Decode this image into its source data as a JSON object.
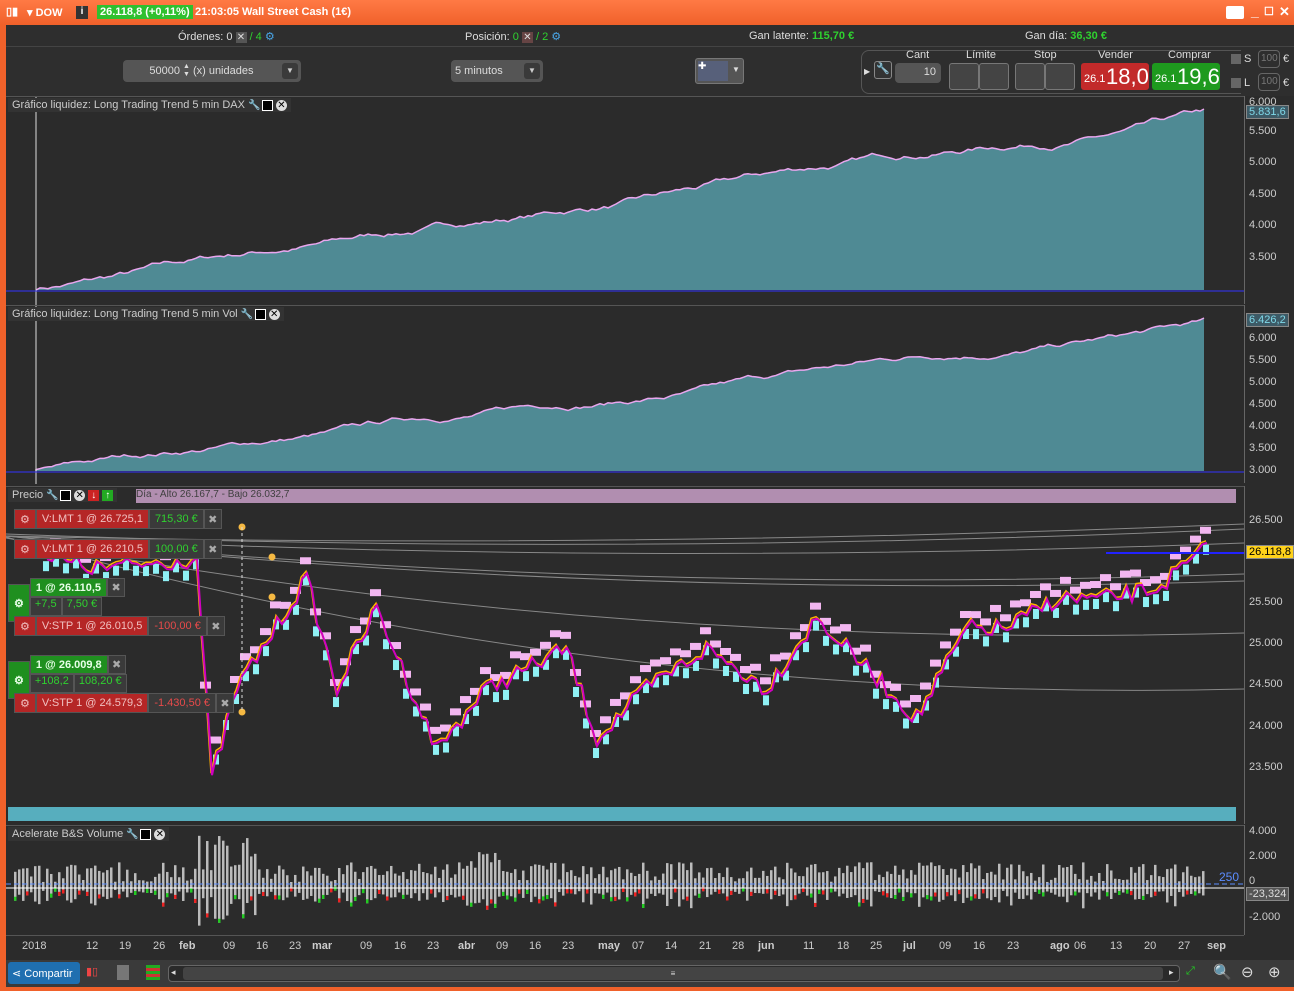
{
  "title": {
    "instrument": "DOW",
    "price": "26.118,8 (+0,11%)",
    "time": "21:03:05",
    "name": "Wall Street Cash (1€)"
  },
  "info": {
    "orders_label": "Órdenes:",
    "orders_a": "0",
    "orders_b": "/ 4",
    "position_label": "Posición:",
    "position_a": "0",
    "position_b": "/ 2",
    "latent_label": "Gan latente:",
    "latent_value": "115,70 €",
    "day_label": "Gan día:",
    "day_value": "36,30 €"
  },
  "controls": {
    "quantity": "50000",
    "units": "(x) unidades",
    "interval": "5 minutos",
    "cant_label": "Cant",
    "cant_value": "10",
    "limit_label": "Límite",
    "stop_label": "Stop",
    "sell_label": "Vender",
    "sell_prefix": "26.1",
    "sell_value": "18,0",
    "buy_label": "Comprar",
    "buy_prefix": "26.1",
    "buy_value": "19,6",
    "s_label": "S",
    "l_label": "L",
    "s_value": "100",
    "l_value": "100",
    "currency": "€"
  },
  "panel1": {
    "title": "Gráfico liquidez: Long Trading Trend 5 min DAX",
    "last": "5.831,6",
    "ticks": [
      "6.000",
      "5.500",
      "5.000",
      "4.500",
      "4.000",
      "3.500"
    ]
  },
  "panel2": {
    "title": "Gráfico liquidez: Long Trading Trend 5 min Vol",
    "last": "6.426,2",
    "ticks": [
      "6.000",
      "5.500",
      "5.000",
      "4.500",
      "4.000",
      "3.500",
      "3.000"
    ]
  },
  "panel3": {
    "title": "Precio",
    "strip": "Día - Alto 26.167,7 - Bajo 26.032,7",
    "last": "26.118,8",
    "ticks": [
      "26.500",
      "25.500",
      "25.000",
      "24.500",
      "24.000",
      "23.500"
    ],
    "orders": [
      {
        "label": "V:LMT  1 @ 26.725,1",
        "pnl": "715,30 €",
        "type": "red"
      },
      {
        "label": "V:LMT  1 @ 26.210,5",
        "pnl": "100,00 €",
        "type": "red"
      },
      {
        "label": "1 @ 26.110,5",
        "pts": "+7,5",
        "pnl": "7,50 €",
        "type": "green"
      },
      {
        "label": "V:STP  1 @ 26.010,5",
        "pnl": "-100,00 €",
        "type": "redneg"
      },
      {
        "label": "1 @ 26.009,8",
        "pts": "+108,2",
        "pnl": "108,20 €",
        "type": "green"
      },
      {
        "label": "V:STP  1 @ 24.579,3",
        "pnl": "-1.430,50 €",
        "type": "redneg"
      }
    ]
  },
  "panel4": {
    "title": "Acelerate B&S Volume",
    "ticks": [
      "4.000",
      "2.000",
      "0",
      "-2.000"
    ],
    "marker": "250",
    "last": "-23,324"
  },
  "dates": [
    "2018",
    "12",
    "19",
    "26",
    "feb",
    "09",
    "16",
    "23",
    "mar",
    "09",
    "16",
    "23",
    "abr",
    "09",
    "16",
    "23",
    "may",
    "07",
    "14",
    "21",
    "28",
    "jun",
    "11",
    "18",
    "25",
    "jul",
    "09",
    "16",
    "23",
    "ago",
    "06",
    "13",
    "20",
    "27",
    "sep"
  ],
  "toolbar": {
    "share": "Compartir"
  }
}
